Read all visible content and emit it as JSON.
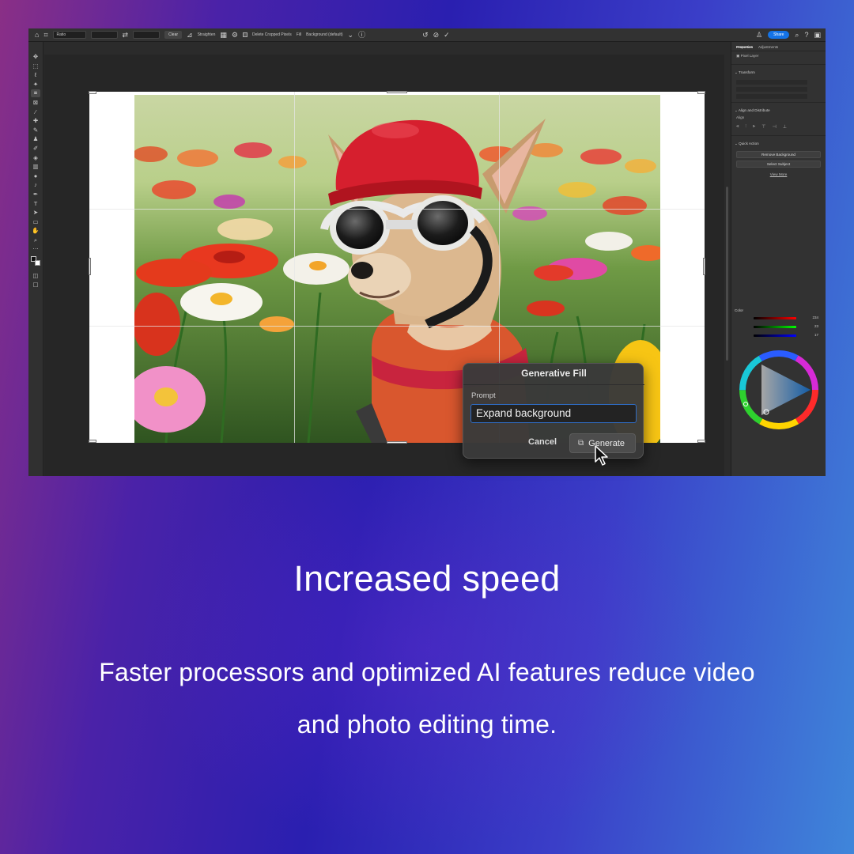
{
  "options_bar": {
    "ratio_label": "Ratio",
    "clear_label": "Clear",
    "straighten_label": "Straighten",
    "delete_cropped_label": "Delete Cropped Pixels",
    "fill_label": "Fill",
    "fill_value": "Background (default)",
    "share_label": "Share"
  },
  "properties_panel": {
    "tab_properties": "Properties",
    "tab_adjustments": "Adjustments",
    "layer_type": "Pixel Layer",
    "transform_label": "Transform",
    "align_distribute_label": "Align and Distribute",
    "align_label": "Align",
    "quick_action_label": "Quick Action",
    "remove_background_label": "Remove Background",
    "select_subject_label": "Select Subject",
    "view_more_label": "View More"
  },
  "color_panel": {
    "title": "Color",
    "values": [
      "234",
      "23",
      "17"
    ]
  },
  "generative_fill": {
    "title": "Generative Fill",
    "prompt_label": "Prompt",
    "prompt_value": "Expand background",
    "cancel_label": "Cancel",
    "generate_label": "Generate"
  },
  "caption": {
    "headline": "Increased speed",
    "body_line1": "Faster processors and optimized AI features reduce video",
    "body_line2": "and photo editing time."
  },
  "colors": {
    "accent_blue": "#1473e6",
    "dialog_bg": "#3a3a3a",
    "app_bg": "#2b2b2b"
  },
  "icons": {
    "home": "home-icon",
    "crop": "crop-icon",
    "undo": "undo-icon",
    "cancel": "cancel-icon",
    "commit": "checkmark-icon",
    "search": "search-icon",
    "help": "help-icon",
    "generate": "sparkle-icon"
  }
}
